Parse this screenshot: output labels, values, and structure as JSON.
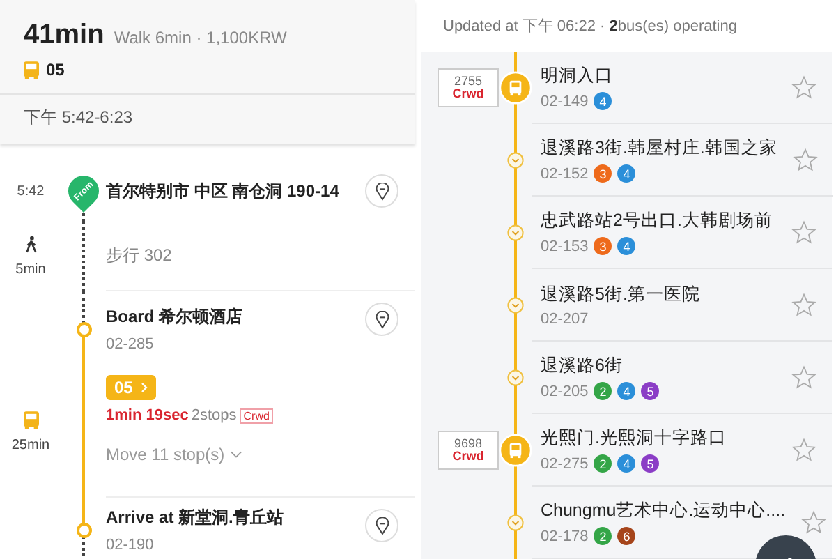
{
  "summary": {
    "duration": "41min",
    "walk_fare": "Walk 6min · 1,100KRW",
    "bus_route": "05",
    "time_range": "下午 5:42-6:23"
  },
  "timeline": [
    {
      "kind": "start",
      "time": "5:42",
      "marker": "From",
      "title": "首尔特别市 中区 南仓洞 190-14"
    },
    {
      "kind": "walk",
      "duration": "5min",
      "text": "步行 302"
    },
    {
      "kind": "board",
      "title": "Board 希尔顿酒店",
      "stop_id": "02-285"
    },
    {
      "kind": "ride",
      "duration": "25min",
      "route": "05",
      "arrival": "1min 19sec",
      "stops": "2stops",
      "crowding": "Crwd",
      "move": "Move 11 stop(s)"
    },
    {
      "kind": "arrive",
      "title": "Arrive at 新堂洞.青丘站",
      "stop_id": "02-190"
    }
  ],
  "status": "Updated at 下午 06:22 · **2**bus(es) operating",
  "stops": [
    {
      "name": "明洞入口",
      "id": "02-149",
      "lines": [
        {
          "label": "4",
          "color": "#2b8fd9"
        }
      ],
      "bus": {
        "number": "2755",
        "crowding": "Crwd"
      }
    },
    {
      "name": "退溪路3街.韩屋村庄.韩国之家",
      "id": "02-152",
      "lines": [
        {
          "label": "3",
          "color": "#ee6a1b"
        },
        {
          "label": "4",
          "color": "#2b8fd9"
        }
      ]
    },
    {
      "name": "忠武路站2号出口.大韩剧场前",
      "id": "02-153",
      "lines": [
        {
          "label": "3",
          "color": "#ee6a1b"
        },
        {
          "label": "4",
          "color": "#2b8fd9"
        }
      ]
    },
    {
      "name": "退溪路5街.第一医院",
      "id": "02-207"
    },
    {
      "name": "退溪路6街",
      "id": "02-205",
      "lines": [
        {
          "label": "2",
          "color": "#34a547"
        },
        {
          "label": "4",
          "color": "#2b8fd9"
        },
        {
          "label": "5",
          "color": "#8b3dc6"
        }
      ]
    },
    {
      "name": "光熙门.光熙洞十字路口",
      "id": "02-275",
      "lines": [
        {
          "label": "2",
          "color": "#34a547"
        },
        {
          "label": "4",
          "color": "#2b8fd9"
        },
        {
          "label": "5",
          "color": "#8b3dc6"
        }
      ],
      "bus": {
        "number": "9698",
        "crowding": "Crwd"
      }
    },
    {
      "name": "Chungmu艺术中心.运动中心....",
      "id": "02-178",
      "lines": [
        {
          "label": "2",
          "color": "#34a547"
        },
        {
          "label": "6",
          "color": "#a6451b"
        }
      ]
    }
  ]
}
